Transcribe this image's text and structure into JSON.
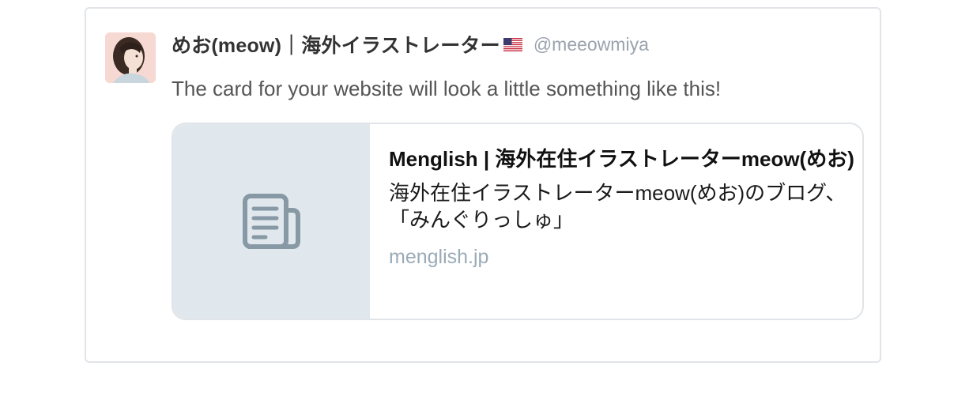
{
  "tweet": {
    "display_name": "めお(meow)｜海外イラストレーター",
    "flag_icon": "us-flag-icon",
    "handle": "@meeowmiya",
    "text": "The card for your website will look a little something like this!"
  },
  "link_card": {
    "thumbnail_icon": "document-icon",
    "title": "Menglish | 海外在住イラストレーターmeow(めお)",
    "description": "海外在住イラストレーターmeow(めお)のブログ、「みんぐりっしゅ」",
    "domain": "menglish.jp"
  },
  "colors": {
    "border": "#e1e4e8",
    "thumbnail_bg": "#e1e8ed",
    "icon": "#8899a6",
    "muted_text": "#9aa3ad"
  }
}
